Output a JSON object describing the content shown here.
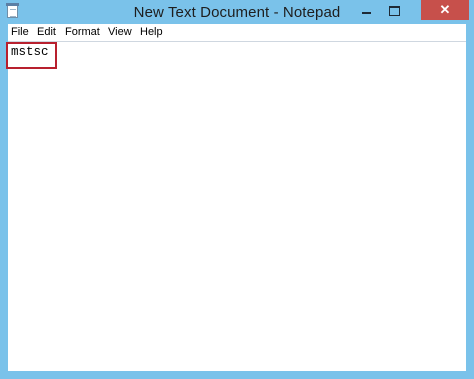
{
  "window": {
    "title": "New Text Document - Notepad",
    "frame_color": "#7ac2ea",
    "close_color": "#c7504b",
    "app_icon": "notepad-icon"
  },
  "controls": {
    "close_glyph": "✕"
  },
  "menu": {
    "items": [
      "File",
      "Edit",
      "Format",
      "View",
      "Help"
    ]
  },
  "editor": {
    "content": "mstsc",
    "highlight_color": "#b8202e"
  }
}
